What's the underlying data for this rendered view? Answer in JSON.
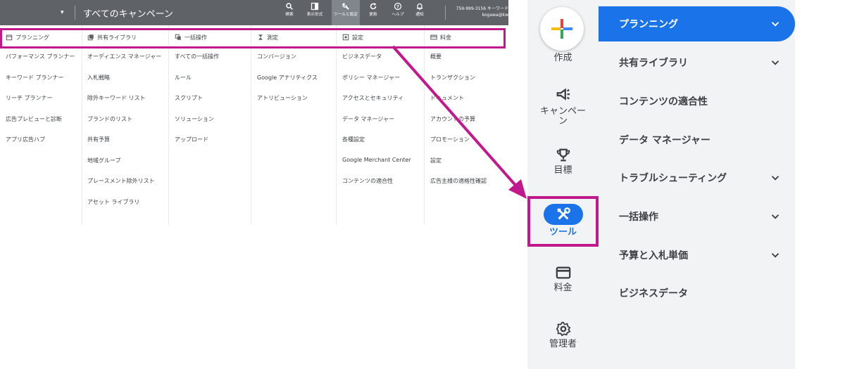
{
  "old_ui": {
    "breadcrumb_dropdown": "▾",
    "page_title": "すべてのキャンペーン",
    "toolbar": [
      {
        "label": "検索",
        "icon": "search-icon"
      },
      {
        "label": "表示形式",
        "icon": "appearance-icon"
      },
      {
        "label": "ツールと設定",
        "icon": "wrench-icon"
      },
      {
        "label": "更新",
        "icon": "refresh-icon"
      },
      {
        "label": "ヘルプ",
        "icon": "help-icon"
      },
      {
        "label": "通知",
        "icon": "bell-icon"
      }
    ],
    "account": {
      "line1": "759-999-3156 キーワード",
      "line2": "kogawa@kw"
    },
    "columns": [
      {
        "header": "プランニング",
        "icon": "calendar-icon",
        "items": [
          "パフォーマンス プランナー",
          "キーワード プランナー",
          "リーチ プランナー",
          "広告プレビューと診断",
          "アプリ広告ハブ"
        ]
      },
      {
        "header": "共有ライブラリ",
        "icon": "library-icon",
        "items": [
          "オーディエンス マネージャー",
          "入札戦略",
          "除外キーワード リスト",
          "ブランドのリスト",
          "共有予算",
          "地域グループ",
          "プレースメント除外リスト",
          "アセット ライブラリ"
        ]
      },
      {
        "header": "一括操作",
        "icon": "copy-icon",
        "items": [
          "すべての一括操作",
          "ルール",
          "スクリプト",
          "ソリューション",
          "アップロード"
        ]
      },
      {
        "header": "測定",
        "icon": "hourglass-icon",
        "items": [
          "コンバージョン",
          "Google アナリティクス",
          "アトリビューション"
        ]
      },
      {
        "header": "設定",
        "icon": "settings-icon",
        "items": [
          "ビジネスデータ",
          "ポリシー マネージャー",
          "アクセスとセキュリティ",
          "データ マネージャー",
          "各種設定",
          "Google Merchant Center",
          "コンテンツの適合性"
        ]
      },
      {
        "header": "料金",
        "icon": "credit-card-icon",
        "items": [
          "概要",
          "トランザクション",
          "ドキュメント",
          "アカウントの予算",
          "プロモーション",
          "設定",
          "広告主様の適格性確認"
        ]
      }
    ]
  },
  "new_ui": {
    "rail": {
      "create": "作成",
      "campaign": "キャンペーン",
      "goals": "目標",
      "tools": "ツール",
      "billing": "料金",
      "admin": "管理者"
    },
    "submenu": [
      {
        "label": "プランニング",
        "expandable": true,
        "active": true
      },
      {
        "label": "共有ライブラリ",
        "expandable": true,
        "active": false
      },
      {
        "label": "コンテンツの適合性",
        "expandable": false,
        "active": false
      },
      {
        "label": "データ マネージャー",
        "expandable": false,
        "active": false
      },
      {
        "label": "トラブルシューティング",
        "expandable": true,
        "active": false
      },
      {
        "label": "一括操作",
        "expandable": true,
        "active": false
      },
      {
        "label": "予算と入札単価",
        "expandable": true,
        "active": false
      },
      {
        "label": "ビジネスデータ",
        "expandable": false,
        "active": false
      }
    ]
  },
  "colors": {
    "highlight": "#c1188b",
    "active_blue": "#1a73e8",
    "topbar": "#5f6368",
    "rail_bg": "#f1f3f4"
  }
}
